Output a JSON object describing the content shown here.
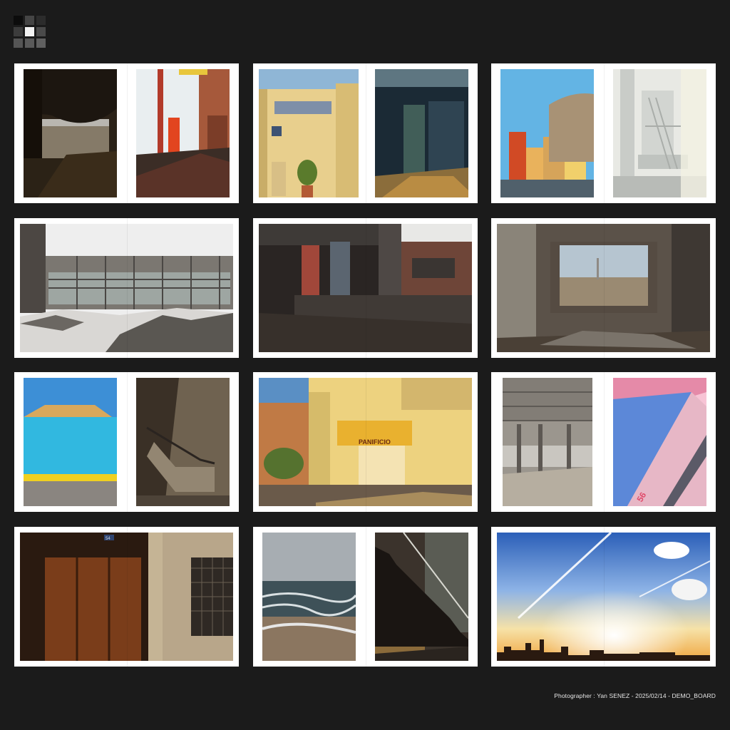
{
  "credit": "Photographer : Yan SENEZ - 2025/02/14 - DEMO_BOARD",
  "colors": {
    "background": "#1b1b1b",
    "mat": "#ffffff"
  },
  "logo": {
    "icon": "pixel-grid-logo",
    "cells": [
      "#0c0c0c",
      "#454545",
      "#2c2c2c",
      "#3c3c3c",
      "#f2f2f2",
      "#4a4a4a",
      "#555555",
      "#5a5a5a",
      "#606060"
    ]
  },
  "spreads": [
    {
      "id": "r1c1",
      "layout": "pair",
      "photos": [
        "dark-terrace-city-view",
        "white-wall-red-door"
      ]
    },
    {
      "id": "r1c2",
      "layout": "pair",
      "photos": [
        "yellow-building-potted-plant",
        "dark-corridor-shadows"
      ]
    },
    {
      "id": "r1c3",
      "layout": "pair",
      "photos": [
        "rooftop-cylinder-tower",
        "misty-industrial-structure"
      ]
    },
    {
      "id": "r2c1",
      "layout": "full",
      "photos": [
        "ruined-factory-debris"
      ]
    },
    {
      "id": "r2c2",
      "layout": "full",
      "photos": [
        "abandoned-concrete-interior"
      ]
    },
    {
      "id": "r2c3",
      "layout": "full",
      "photos": [
        "ruined-room-window-city"
      ]
    },
    {
      "id": "r3c1",
      "layout": "pair",
      "photos": [
        "blue-wall-yellow-curb",
        "stairway-railing-light"
      ]
    },
    {
      "id": "r3c2",
      "layout": "full",
      "photos": [
        "yellow-bakery-facade"
      ],
      "sign": "PANIFICIO"
    },
    {
      "id": "r3c3",
      "layout": "pair",
      "photos": [
        "abandoned-hall-columns",
        "pink-blue-pool-edge"
      ],
      "number": "56"
    },
    {
      "id": "r4c1",
      "layout": "full",
      "photos": [
        "wooden-doors-facade"
      ],
      "door_number": "54"
    },
    {
      "id": "r4c2",
      "layout": "pair",
      "photos": [
        "stormy-sea-waves",
        "floating-staircase"
      ]
    },
    {
      "id": "r4c3",
      "layout": "full",
      "photos": [
        "sunset-sky-contrails-skyline"
      ]
    }
  ]
}
